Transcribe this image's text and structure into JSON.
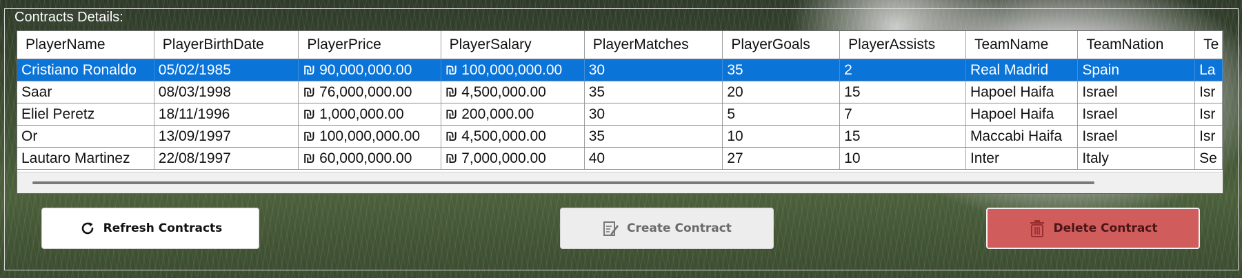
{
  "group": {
    "label": "Contracts Details:"
  },
  "grid": {
    "columns": [
      "PlayerName",
      "PlayerBirthDate",
      "PlayerPrice",
      "PlayerSalary",
      "PlayerMatches",
      "PlayerGoals",
      "PlayerAssists",
      "TeamName",
      "TeamNation",
      "Te"
    ],
    "rows": [
      [
        "Cristiano Ronaldo",
        "05/02/1985",
        "₪ 90,000,000.00",
        "₪ 100,000,000.00",
        "30",
        "35",
        "2",
        "Real Madrid",
        "Spain",
        "La"
      ],
      [
        "Saar",
        "08/03/1998",
        "₪ 76,000,000.00",
        "₪ 4,500,000.00",
        "35",
        "20",
        "15",
        "Hapoel Haifa",
        "Israel",
        "Isr"
      ],
      [
        "Eliel Peretz",
        "18/11/1996",
        "₪ 1,000,000.00",
        "₪ 200,000.00",
        "30",
        "5",
        "7",
        "Hapoel Haifa",
        "Israel",
        "Isr"
      ],
      [
        "Or",
        "13/09/1997",
        "₪ 100,000,000.00",
        "₪ 4,500,000.00",
        "35",
        "10",
        "15",
        "Maccabi Haifa",
        "Israel",
        "Isr"
      ],
      [
        "Lautaro Martinez",
        "22/08/1997",
        "₪ 60,000,000.00",
        "₪ 7,000,000.00",
        "40",
        "27",
        "10",
        "Inter",
        "Italy",
        "Se"
      ]
    ],
    "selected_row": 0,
    "colors": {
      "selection": "#0a74d9"
    }
  },
  "buttons": {
    "refresh": {
      "label": "Refresh Contracts",
      "icon": "refresh-icon"
    },
    "create": {
      "label": "Create Contract",
      "icon": "document-edit-icon",
      "enabled": false
    },
    "delete": {
      "label": "Delete Contract",
      "icon": "trash-icon",
      "color": "#d15c5c"
    }
  }
}
